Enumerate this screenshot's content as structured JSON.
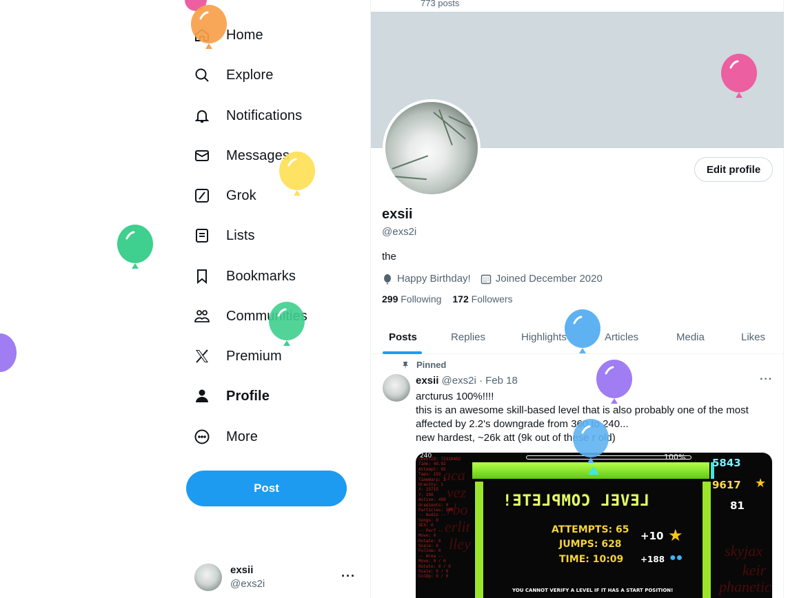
{
  "nav": {
    "items": [
      {
        "label": "Home",
        "icon": "home-icon"
      },
      {
        "label": "Explore",
        "icon": "search-icon"
      },
      {
        "label": "Notifications",
        "icon": "bell-icon"
      },
      {
        "label": "Messages",
        "icon": "envelope-icon"
      },
      {
        "label": "Grok",
        "icon": "grok-icon"
      },
      {
        "label": "Lists",
        "icon": "list-icon"
      },
      {
        "label": "Bookmarks",
        "icon": "bookmark-icon"
      },
      {
        "label": "Communities",
        "icon": "communities-icon"
      },
      {
        "label": "Premium",
        "icon": "x-logo-icon"
      },
      {
        "label": "Profile",
        "icon": "person-icon"
      },
      {
        "label": "More",
        "icon": "more-circle-icon"
      }
    ],
    "post_button": "Post",
    "account": {
      "name": "exsii",
      "handle": "@exs2i",
      "more": "···"
    }
  },
  "profile": {
    "posts_count": "773 posts",
    "edit_button": "Edit profile",
    "name": "exsii",
    "handle": "@exs2i",
    "bio": "the",
    "birthday": "Happy Birthday!",
    "joined": "Joined December 2020",
    "following_count": "299",
    "following_label": "Following",
    "followers_count": "172",
    "followers_label": "Followers"
  },
  "tabs": [
    "Posts",
    "Replies",
    "Highlights",
    "Articles",
    "Media",
    "Likes"
  ],
  "post": {
    "pinned_label": "Pinned",
    "author": "exsii",
    "handle": "@exs2i",
    "date": "· Feb 18",
    "more": "···",
    "lines": [
      "arcturus 100%!!!!",
      "this is an awesome skill-based level that is also probably one of the most affected by 2.2's downgrade from 360 to 240...",
      "new hardest, ~26k att (9k out of these r old)"
    ],
    "image": {
      "banner_text": "LEVEL COMPLETE!",
      "attempts": "ATTEMPTS: 65",
      "jumps": "JUMPS: 628",
      "time": "TIME: 10:09",
      "bonus_top": "+10",
      "bonus_bottom": "+188",
      "orbs": "5843",
      "stars": "9617",
      "keys": "81",
      "progress": "100%",
      "fps": "240",
      "footer": "YOU CANNOT VERIFY A LEVEL IF IT HAS A START POSITION!",
      "stats_text": "LevelID: 72318402\nTime: 48.92\nAttempt: 65\nTaps: 153\nTimeWarp: 1\nGravity: 1\nX: 23715\nY: 290\nActive: 458\nGradients: 0\nParticles: 100\n-- Audio --\nSongs: 0\nSFX: 0\n-- Perf --\nMove: 0\nRotate: 0\nScale: 0\nFollow: 0\n-- Area --\nMove: 0 / 0\nRotate: 0 / 0\nScale: 0 / 0\nColOp: 0 / 0",
      "bg_names": [
        "skyjax",
        "keir",
        "phanetic"
      ]
    }
  },
  "colors": {
    "accent": "#1d9bf0",
    "banner": "#cfd9de",
    "balloon_orange": "#f7a04b",
    "balloon_pink": "#ec5fa1",
    "balloon_yellow": "#fde05c",
    "balloon_green": "#3fcf8e",
    "balloon_blue": "#5fb2f2",
    "balloon_purple": "#a07df2"
  }
}
